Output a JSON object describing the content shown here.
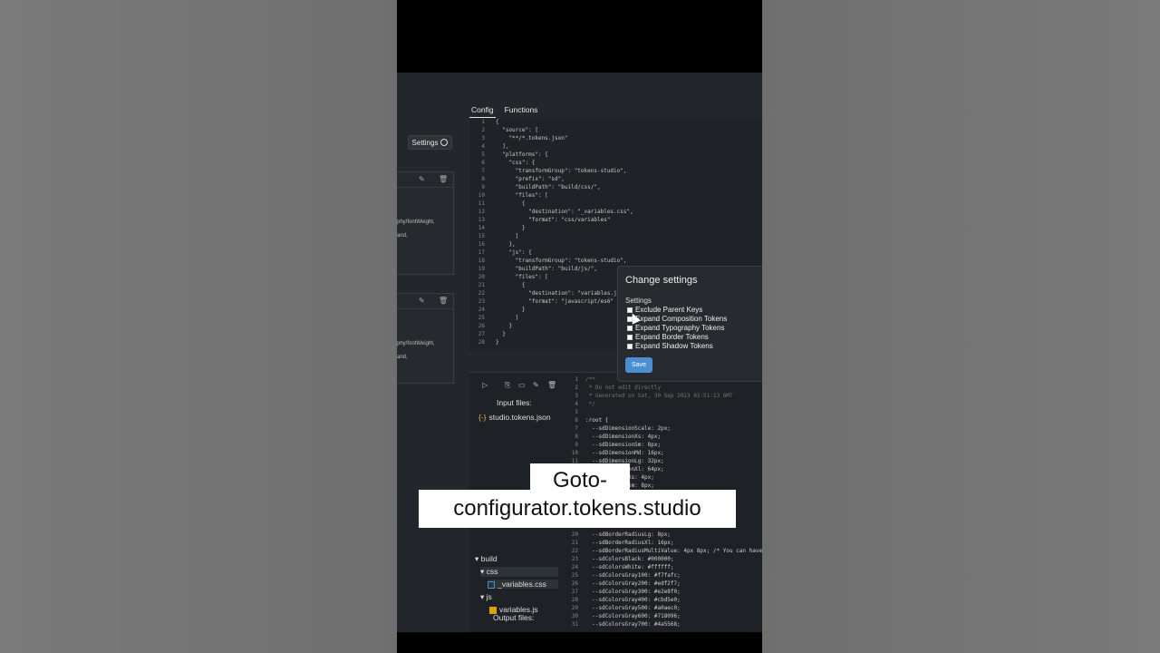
{
  "left_panel": {
    "settings_label": "Settings",
    "card1_lines": [
      "phy/fontWeight,",
      "and,"
    ],
    "card2_lines": [
      "phy/fontWeight,",
      "and,"
    ]
  },
  "tabs": [
    {
      "label": "Config",
      "active": true
    },
    {
      "label": "Functions",
      "active": false
    }
  ],
  "config_lines": [
    {
      "n": "1",
      "t": "{"
    },
    {
      "n": "2",
      "t": "  \"source\": ["
    },
    {
      "n": "3",
      "t": "    \"**/*.tokens.json\""
    },
    {
      "n": "4",
      "t": "  ],"
    },
    {
      "n": "5",
      "t": "  \"platforms\": {"
    },
    {
      "n": "6",
      "t": "    \"css\": {"
    },
    {
      "n": "7",
      "t": "      \"transformGroup\": \"tokens-studio\","
    },
    {
      "n": "8",
      "t": "      \"prefix\": \"sd\","
    },
    {
      "n": "9",
      "t": "      \"buildPath\": \"build/css/\","
    },
    {
      "n": "10",
      "t": "      \"files\": ["
    },
    {
      "n": "11",
      "t": "        {"
    },
    {
      "n": "12",
      "t": "          \"destination\": \"_variables.css\","
    },
    {
      "n": "13",
      "t": "          \"format\": \"css/variables\""
    },
    {
      "n": "14",
      "t": "        }"
    },
    {
      "n": "15",
      "t": "      ]"
    },
    {
      "n": "16",
      "t": "    },"
    },
    {
      "n": "17",
      "t": "    \"js\": {"
    },
    {
      "n": "18",
      "t": "      \"transformGroup\": \"tokens-studio\","
    },
    {
      "n": "19",
      "t": "      \"buildPath\": \"build/js/\","
    },
    {
      "n": "20",
      "t": "      \"files\": ["
    },
    {
      "n": "21",
      "t": "        {"
    },
    {
      "n": "22",
      "t": "          \"destination\": \"variables.j"
    },
    {
      "n": "23",
      "t": "          \"format\": \"javascript/es6\""
    },
    {
      "n": "24",
      "t": "        }"
    },
    {
      "n": "25",
      "t": "      ]"
    },
    {
      "n": "26",
      "t": "    }"
    },
    {
      "n": "27",
      "t": "  }"
    },
    {
      "n": "28",
      "t": "}"
    }
  ],
  "modal": {
    "title": "Change settings",
    "section": "Settings",
    "options": [
      "Exclude Parent Keys",
      "Expand Composition Tokens",
      "Expand Typography Tokens",
      "Expand Border Tokens",
      "Expand Shadow Tokens"
    ],
    "save_label": "Save"
  },
  "input_files": {
    "title": "Input files:",
    "files": [
      "studio.tokens.json"
    ]
  },
  "output_files": {
    "title": "Output files:",
    "tree": [
      "build",
      "css",
      "_variables.css",
      "js",
      "variables.js"
    ]
  },
  "output_lines": [
    {
      "n": "1",
      "t": "/**",
      "c": "cmt"
    },
    {
      "n": "2",
      "t": " * Do not edit directly",
      "c": "cmt"
    },
    {
      "n": "3",
      "t": " * Generated on Sat, 30 Sep 2023 02:51:13 GMT",
      "c": "cmt"
    },
    {
      "n": "4",
      "t": " */",
      "c": "cmt"
    },
    {
      "n": "5",
      "t": "",
      "c": "var"
    },
    {
      "n": "6",
      "t": ":root {",
      "c": "var"
    },
    {
      "n": "7",
      "t": "  --sdDimensionScale: 2px;",
      "c": "var"
    },
    {
      "n": "8",
      "t": "  --sdDimensionXs: 4px;",
      "c": "var"
    },
    {
      "n": "9",
      "t": "  --sdDimensionSm: 8px;",
      "c": "var"
    },
    {
      "n": "10",
      "t": "  --sdDimensionMd: 16px;",
      "c": "var"
    },
    {
      "n": "11",
      "t": "  --sdDimensionLg: 32px;",
      "c": "var"
    },
    {
      "n": "12",
      "t": "  --sdDimensionXl: 64px;",
      "c": "var"
    },
    {
      "n": "13",
      "t": "  --sdSpacingXs: 4px;",
      "c": "var"
    },
    {
      "n": "14",
      "t": "  --sdSpacingSm: 8px;",
      "c": "var"
    },
    {
      "n": "20",
      "t": "  --sdBorderRadiusLg: 8px;",
      "c": "var"
    },
    {
      "n": "21",
      "t": "  --sdBorderRadiusXl: 16px;",
      "c": "var"
    },
    {
      "n": "22",
      "t": "  --sdBorderRadiusMultiValue: 4px 8px; /* You can have",
      "c": "var"
    },
    {
      "n": "23",
      "t": "  --sdColorsBlack: #000000;",
      "c": "var"
    },
    {
      "n": "24",
      "t": "  --sdColorsWhite: #ffffff;",
      "c": "var"
    },
    {
      "n": "25",
      "t": "  --sdColorsGray100: #f7fafc;",
      "c": "var"
    },
    {
      "n": "26",
      "t": "  --sdColorsGray200: #edf2f7;",
      "c": "var"
    },
    {
      "n": "27",
      "t": "  --sdColorsGray300: #e2e8f0;",
      "c": "var"
    },
    {
      "n": "28",
      "t": "  --sdColorsGray400: #cbd5e0;",
      "c": "var"
    },
    {
      "n": "29",
      "t": "  --sdColorsGray500: #a0aec0;",
      "c": "var"
    },
    {
      "n": "30",
      "t": "  --sdColorsGray600: #718096;",
      "c": "var"
    },
    {
      "n": "31",
      "t": "  --sdColorsGray700: #4a5568;",
      "c": "var"
    }
  ],
  "caption": {
    "line1": "Goto-",
    "line2": "configurator.tokens.studio"
  }
}
